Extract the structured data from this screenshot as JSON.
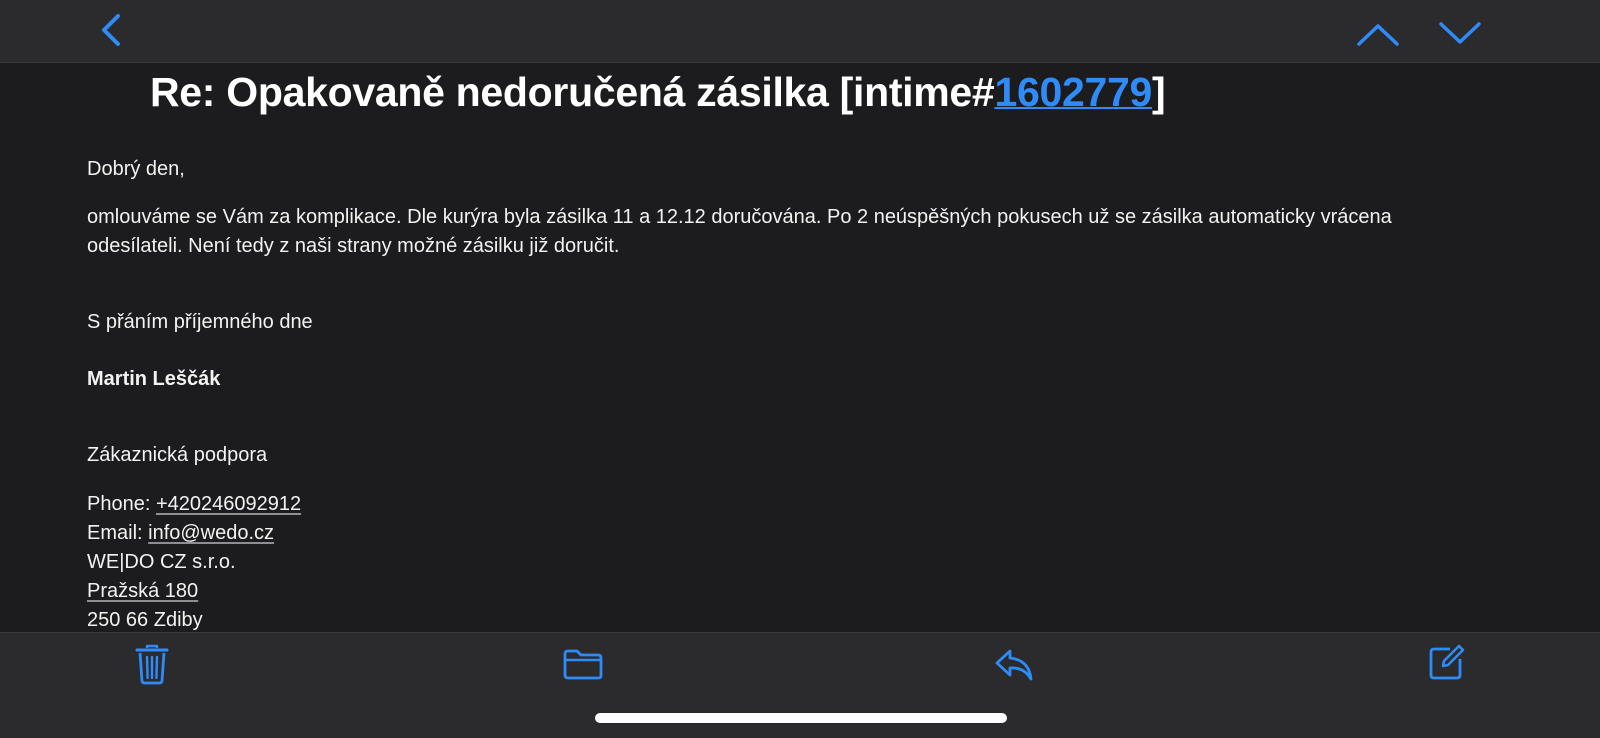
{
  "nav": {
    "back_icon": "chevron-left-icon",
    "prev_icon": "chevron-up-icon",
    "next_icon": "chevron-down-icon",
    "accent": "#2f8bf7"
  },
  "email": {
    "subject_prefix": "Re: Opakovaně nedoručená zásilka [intime#",
    "subject_ticket": "1602779",
    "subject_suffix": "]",
    "greeting": "Dobrý den,",
    "paragraph_line1": "omlouváme se Vám za komplikace. Dle kurýra byla zásilka 11 a 12.12 doručována. Po 2 neúspěšných pokusech už se zásilka automaticky vrácena",
    "paragraph_line2": "odesílateli. Není tedy z naši strany možné zásilku již doručit.",
    "closing": "S přáním příjemného dne",
    "signature_name": "Martin Leščák",
    "department": "Zákaznická podpora",
    "phone_label": "Phone: ",
    "phone_value": "+420246092912",
    "email_label": "Email: ",
    "email_value": "info@wedo.cz",
    "company": "WE|DO CZ s.r.o.",
    "street": "Pražská 180",
    "city": "250 66 Zdiby"
  },
  "toolbar": {
    "trash_icon": "trash-icon",
    "folder_icon": "folder-icon",
    "reply_icon": "reply-icon",
    "compose_icon": "compose-icon"
  },
  "colors": {
    "background": "#1c1c1e",
    "bar": "#2b2b2e",
    "text": "#ffffff",
    "link": "#2f8bf7"
  }
}
